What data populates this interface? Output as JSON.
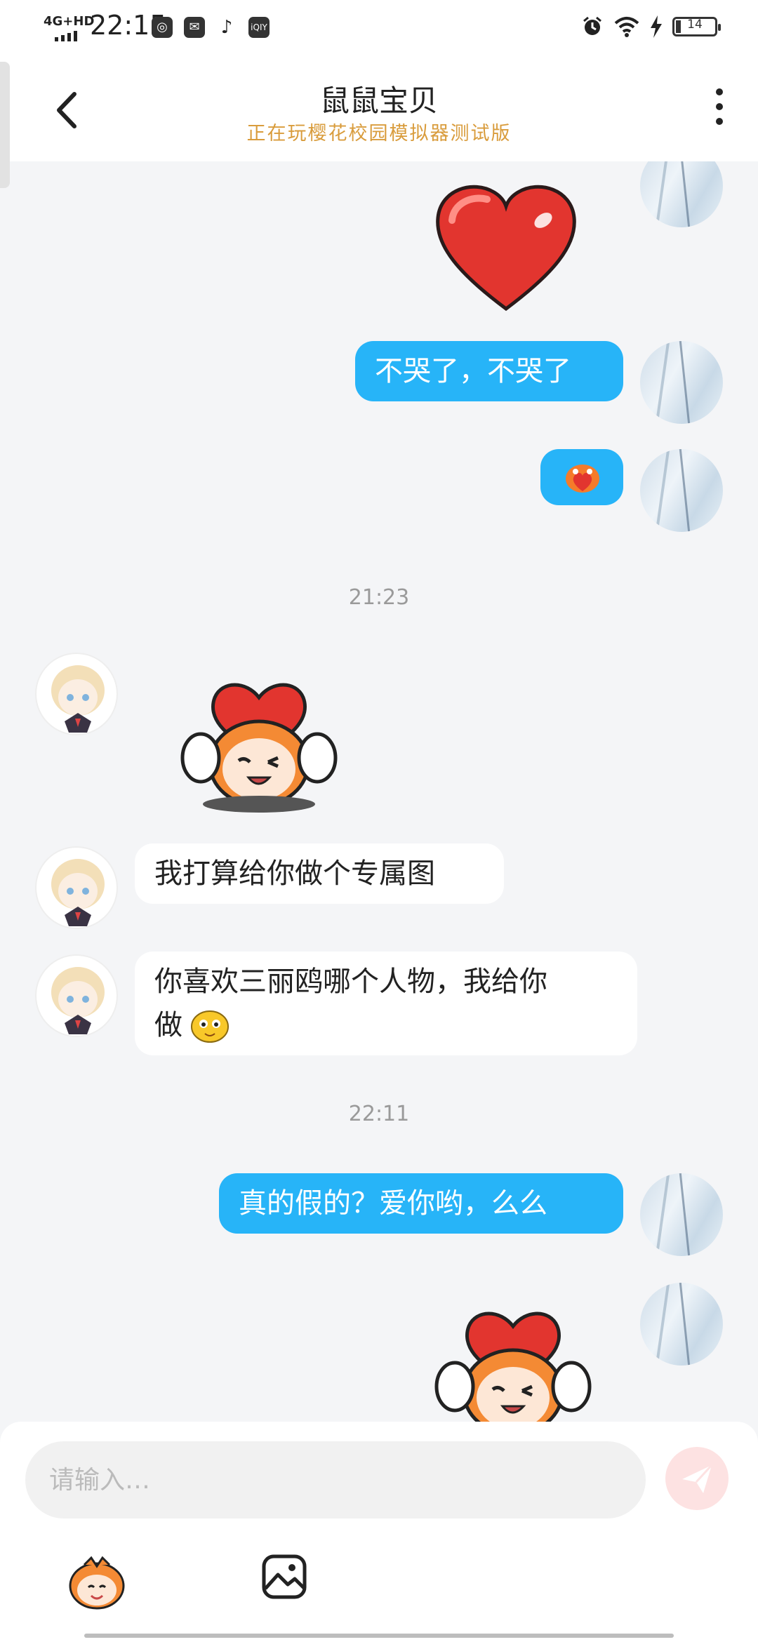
{
  "status_bar": {
    "network": "4G+HD",
    "time": "22:15",
    "app_icons": [
      "qq-icon",
      "mail-icon",
      "tiktok-icon",
      "iqiyi-icon"
    ],
    "battery": "14"
  },
  "header": {
    "title": "鼠鼠宝贝",
    "subtitle": "正在玩樱花校园模拟器测试版"
  },
  "messages": [
    {
      "side": "out",
      "type": "sticker",
      "sticker": "red-heart"
    },
    {
      "side": "out",
      "type": "text",
      "text": "不哭了，不哭了"
    },
    {
      "side": "out",
      "type": "sticker",
      "sticker": "small-emoji-holding-heart"
    },
    {
      "type": "time",
      "text": "21:23"
    },
    {
      "side": "in",
      "type": "sticker",
      "sticker": "character-holding-heart"
    },
    {
      "side": "in",
      "type": "text",
      "text": "我打算给你做个专属图"
    },
    {
      "side": "in",
      "type": "text",
      "text": "你喜欢三丽鸥哪个人物，我给你",
      "text2": "做"
    },
    {
      "type": "time",
      "text": "22:11"
    },
    {
      "side": "out",
      "type": "text",
      "text": "真的假的？爱你哟，么么"
    },
    {
      "side": "out",
      "type": "sticker",
      "sticker": "character-holding-heart"
    }
  ],
  "input": {
    "placeholder": "请输入…"
  },
  "colors": {
    "outgoing_bubble": "#27b4f8",
    "incoming_bubble": "#ffffff",
    "subtitle": "#d99c3c",
    "background": "#f4f5f7"
  }
}
